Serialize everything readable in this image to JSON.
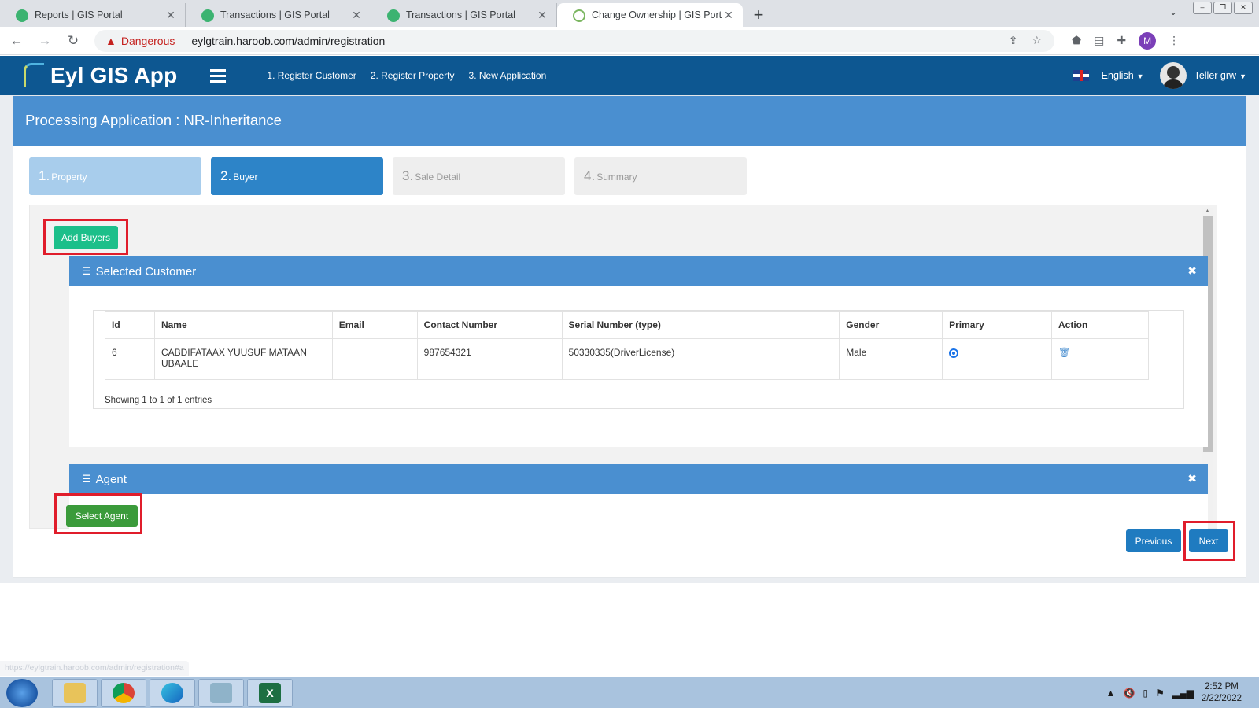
{
  "browser": {
    "tabs": [
      {
        "title": "Reports | GIS Portal",
        "active": false
      },
      {
        "title": "Transactions | GIS Portal",
        "active": false
      },
      {
        "title": "Transactions | GIS Portal",
        "active": false
      },
      {
        "title": "Change Ownership | GIS Portal",
        "active": true
      }
    ],
    "security_label": "Dangerous",
    "url": "eylgtrain.haroob.com/admin/registration",
    "profile_initial": "M",
    "status_url": "https://eylgtrain.haroob.com/admin/registration#a"
  },
  "app": {
    "name": "Eyl GIS App",
    "nav": [
      "1. Register Customer",
      "2. Register Property",
      "3. New Application"
    ],
    "language": "English",
    "user": "Teller grw"
  },
  "page": {
    "title": "Processing Application : NR-Inheritance",
    "steps": [
      {
        "num": "1.",
        "label": "Property",
        "state": "done"
      },
      {
        "num": "2.",
        "label": "Buyer",
        "state": "current"
      },
      {
        "num": "3.",
        "label": "Sale Detail",
        "state": "future"
      },
      {
        "num": "4.",
        "label": "Summary",
        "state": "future"
      }
    ],
    "add_buyers_label": "Add Buyers",
    "selected_customer": {
      "title": "Selected Customer",
      "columns": [
        "Id",
        "Name",
        "Email",
        "Contact Number",
        "Serial Number (type)",
        "Gender",
        "Primary",
        "Action"
      ],
      "rows": [
        {
          "id": "6",
          "name": "CABDIFATAAX YUUSUF MATAAN UBAALE",
          "email": "",
          "contact": "987654321",
          "serial": "50330335(DriverLicense)",
          "gender": "Male",
          "primary": true
        }
      ],
      "info": "Showing 1 to 1 of 1 entries"
    },
    "agent": {
      "title": "Agent",
      "select_label": "Select Agent"
    },
    "previous_label": "Previous",
    "next_label": "Next"
  },
  "taskbar": {
    "time": "2:52 PM",
    "date": "2/22/2022"
  },
  "colors": {
    "app_header": "#0d5791",
    "card_header": "#4a8fd0",
    "step_current": "#2d84c8",
    "add_button": "#1cbf8a",
    "agent_button": "#3b9b3b",
    "highlight": "#e01d2b"
  }
}
